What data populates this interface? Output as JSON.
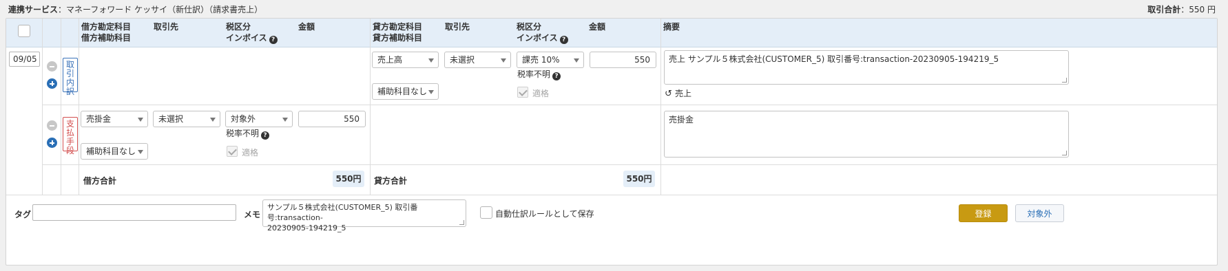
{
  "top": {
    "service_label": "連携サービス",
    "service_value": "：マネーフォワード ケッサイ（新仕訳）（請求書売上）",
    "total_label": "取引合計",
    "total_value": "：550 円"
  },
  "header": {
    "debit_account": "借方勘定科目",
    "debit_sub_account": "借方補助科目",
    "debit_partner": "取引先",
    "debit_tax": "税区分",
    "debit_invoice": "インボイス",
    "debit_amount": "金額",
    "credit_account": "貸方勘定科目",
    "credit_sub_account": "貸方補助科目",
    "credit_partner": "取引先",
    "credit_tax": "税区分",
    "credit_invoice": "インボイス",
    "credit_amount": "金額",
    "summary": "摘要"
  },
  "row1": {
    "date": "09/05",
    "tag": "取引内訳",
    "credit_account": "売上高",
    "credit_partner": "未選択",
    "credit_tax": "課売 10%",
    "credit_amount": "550",
    "tax_rate_unknown": "税率不明",
    "credit_sub_account": "補助科目なし",
    "qualified": "適格",
    "summary": "売上 サンプル５株式会社(CUSTOMER_5) 取引番号:transaction-20230905-194219_5",
    "undo_label": "売上"
  },
  "row2": {
    "tag": "支払手段",
    "debit_account": "売掛金",
    "debit_partner": "未選択",
    "debit_tax": "対象外",
    "debit_amount": "550",
    "tax_rate_unknown": "税率不明",
    "debit_sub_account": "補助科目なし",
    "qualified": "適格",
    "summary": "売掛金"
  },
  "totals": {
    "debit_label": "借方合計",
    "debit_value": "550円",
    "credit_label": "貸方合計",
    "credit_value": "550円"
  },
  "footer": {
    "tag_label": "タグ",
    "tag_value": "",
    "memo_label": "メモ",
    "memo_line1": "サンプル５株式会社(CUSTOMER_5) 取引番号:transaction-",
    "memo_line2": "20230905-194219_5",
    "auto_rule_label": "自動仕訳ルールとして保存",
    "register_button": "登録",
    "exclude_button": "対象外"
  }
}
